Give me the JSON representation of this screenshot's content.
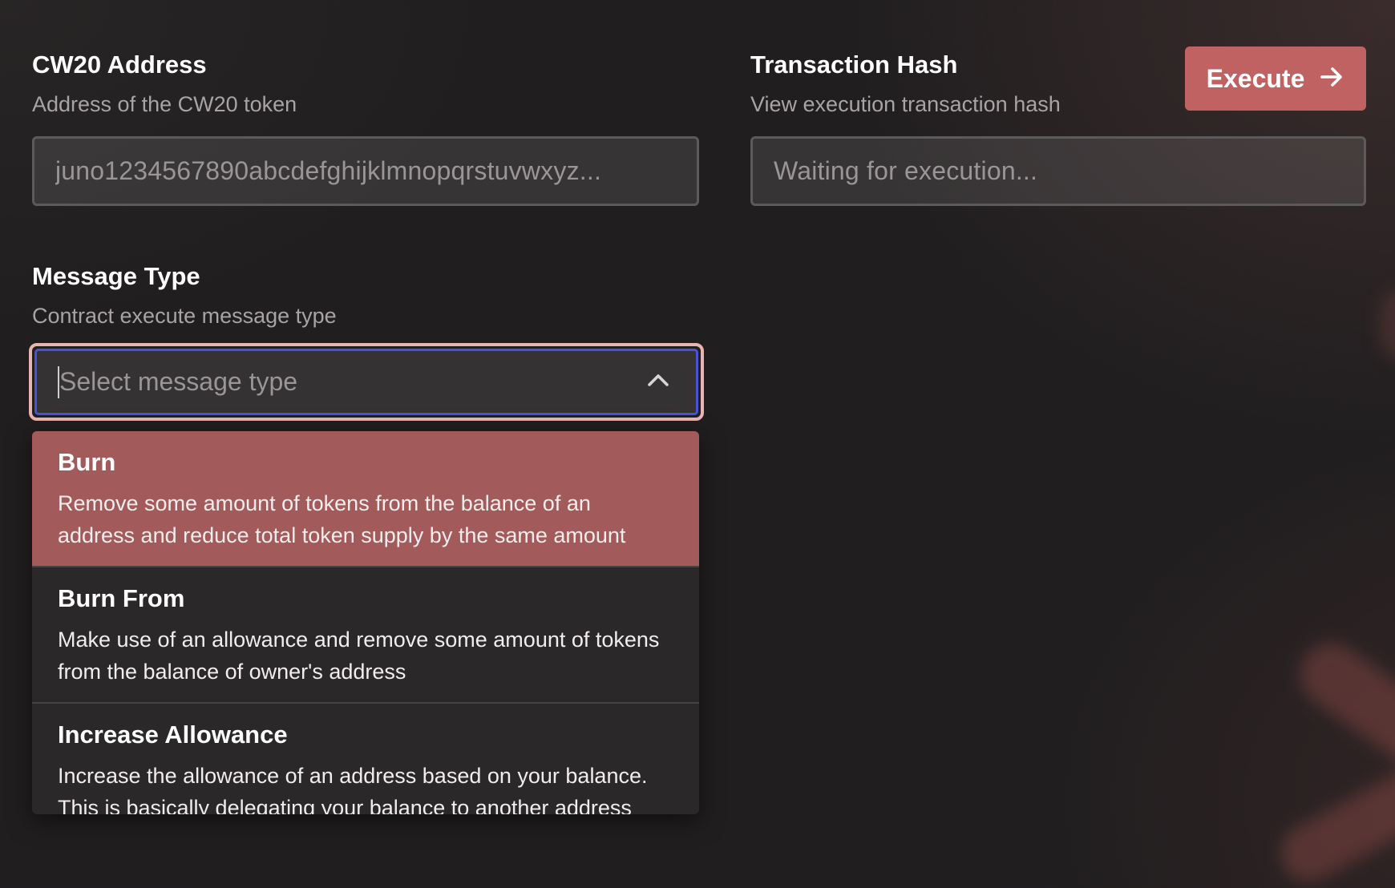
{
  "cw20": {
    "title": "CW20 Address",
    "description": "Address of the CW20 token",
    "value": "juno1234567890abcdefghijklmnopqrstuvwxyz..."
  },
  "transaction": {
    "title": "Transaction Hash",
    "description": "View execution transaction hash",
    "value": "Waiting for execution..."
  },
  "execute_button": {
    "label": "Execute",
    "icon": "arrow-right-icon",
    "color": "#c06261"
  },
  "message_type": {
    "title": "Message Type",
    "description": "Contract execute message type",
    "placeholder": "Select message type",
    "toggle_icon": "chevron-up-icon",
    "options": [
      {
        "title": "Burn",
        "description": "Remove some amount of tokens from the balance of an address and reduce total token supply by the same amount"
      },
      {
        "title": "Burn From",
        "description": "Make use of an allowance and remove some amount of tokens from the balance of owner's address"
      },
      {
        "title": "Increase Allowance",
        "description": "Increase the allowance of an address based on your balance. This is basically delegating your balance to another address"
      }
    ]
  },
  "colors": {
    "background": "#201e1f",
    "active_option": "#a35a5b",
    "focus_ring": "#4a53d8",
    "focus_outline": "#e9b5b2"
  }
}
